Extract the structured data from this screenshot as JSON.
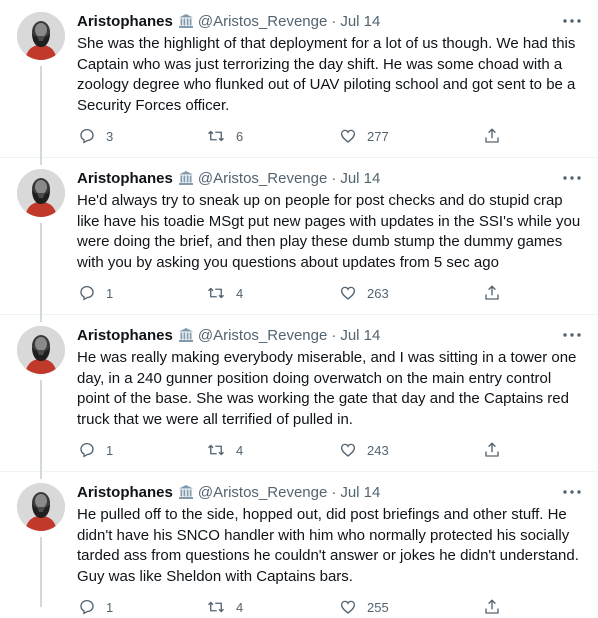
{
  "colors": {
    "text": "#0f1419",
    "secondary": "#536471",
    "divider": "#eff3f4",
    "background": "#ffffff"
  },
  "tweets": [
    {
      "name": "Aristophanes",
      "badge_icon": "government-building-icon",
      "handle": "@Aristos_Revenge",
      "separator": "·",
      "date": "Jul 14",
      "text": "She was the highlight of that deployment for a lot of us though. We had this Captain who was just terrorizing the day shift. He was some choad with a zoology degree who flunked out of UAV piloting school and got sent to be a Security Forces officer.",
      "replies": "3",
      "retweets": "6",
      "likes": "277"
    },
    {
      "name": "Aristophanes",
      "badge_icon": "government-building-icon",
      "handle": "@Aristos_Revenge",
      "separator": "·",
      "date": "Jul 14",
      "text": "He'd always try to sneak up on people for post checks and do stupid crap like have his toadie MSgt put new pages with updates in the SSI's while you were doing the brief, and then play these dumb stump the dummy games with you by asking you questions about updates from 5 sec ago",
      "replies": "1",
      "retweets": "4",
      "likes": "263"
    },
    {
      "name": "Aristophanes",
      "badge_icon": "government-building-icon",
      "handle": "@Aristos_Revenge",
      "separator": "·",
      "date": "Jul 14",
      "text": "He was really making everybody miserable, and I was sitting in a tower one day, in a 240 gunner position doing overwatch on the main entry control point of the base. She was working the gate that day and the Captains red truck that we were all terrified of pulled in.",
      "replies": "1",
      "retweets": "4",
      "likes": "243"
    },
    {
      "name": "Aristophanes",
      "badge_icon": "government-building-icon",
      "handle": "@Aristos_Revenge",
      "separator": "·",
      "date": "Jul 14",
      "text": "He pulled off to the side, hopped out, did post briefings and other stuff. He didn't have his SNCO handler with him who normally protected his socially tarded ass from questions he couldn't answer or jokes he didn't understand. Guy was like Sheldon with Captains bars.",
      "replies": "1",
      "retweets": "4",
      "likes": "255"
    }
  ]
}
